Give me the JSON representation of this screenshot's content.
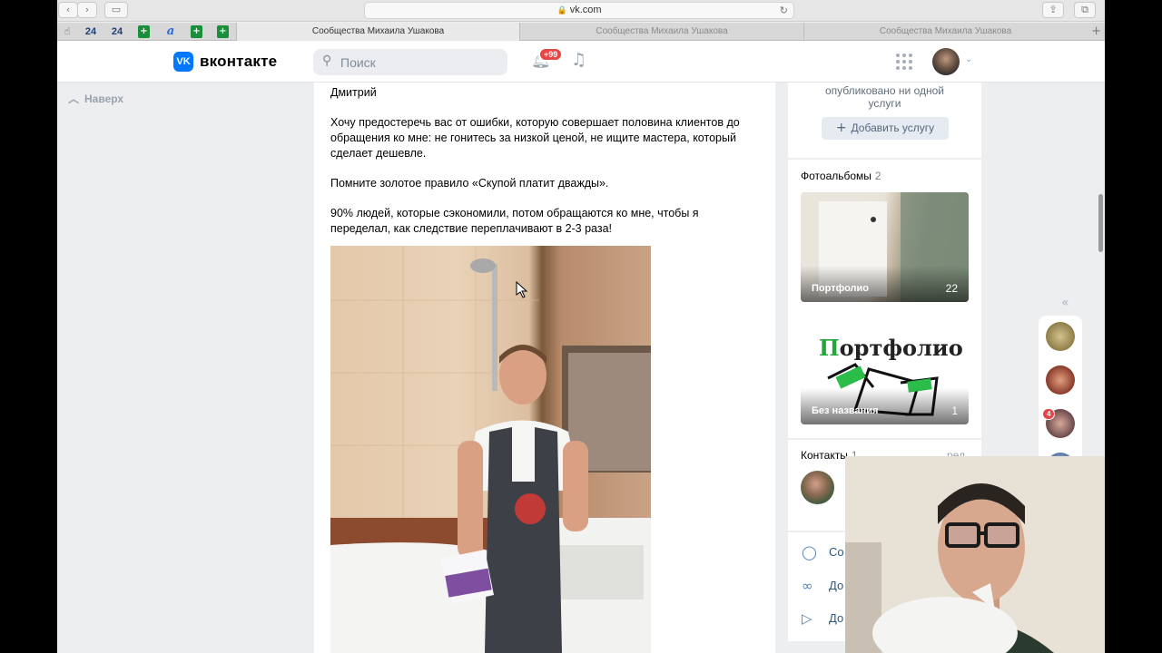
{
  "browser": {
    "url": "vk.com",
    "tabs": [
      "Сообщества Михаила Ушакова",
      "Сообщества Михаила Ушакова",
      "Сообщества Михаила Ушакова"
    ],
    "favorites": [
      "24",
      "24"
    ]
  },
  "header": {
    "logo_text": "вконтакте",
    "logo_mark": "VK",
    "search_placeholder": "Поиск",
    "notifications_badge": "+99"
  },
  "left": {
    "up_label": "Наверх"
  },
  "post": {
    "author": "Дмитрий",
    "paragraphs": [
      "Хочу предостеречь вас от ошибки, которую совершает половина клиентов до обращения ко мне: не гонитесь за низкой ценой, не ищите мастера, который сделает дешевле.",
      "Помните золотое правило «Скупой платит дважды».",
      "90% людей, которые сэкономили, потом обращаются ко мне, чтобы я переделал, как следствие переплачивают в 2-3 раза!"
    ]
  },
  "services": {
    "text_line1": "опубликовано ни одной",
    "text_line2": "услуги",
    "add_button": "Добавить услугу"
  },
  "albums": {
    "title": "Фотоальбомы",
    "count": "2",
    "items": [
      {
        "label": "Портфолио",
        "count": "22"
      },
      {
        "label": "Без названия",
        "count": "1",
        "cover_text": "Портфолио"
      }
    ]
  },
  "contacts": {
    "title": "Контакты",
    "count": "1",
    "edit": "ред."
  },
  "cut_links": [
    "Со",
    "До",
    "До"
  ],
  "rail": {
    "badges": [
      "4"
    ]
  },
  "icons": {
    "back": "chevron-left-icon",
    "forward": "chevron-right-icon",
    "sidebar": "sidebar-icon",
    "lock": "lock-icon",
    "reload": "reload-icon",
    "share": "share-icon",
    "tabs": "tabs-icon",
    "search": "search-icon",
    "bell": "bell-icon",
    "music": "music-note-icon",
    "apps": "apps-grid-icon"
  },
  "colors": {
    "vk_blue": "#0077ff",
    "badge_red": "#e64646",
    "link": "#2a5885",
    "page_bg": "#edeef0"
  }
}
